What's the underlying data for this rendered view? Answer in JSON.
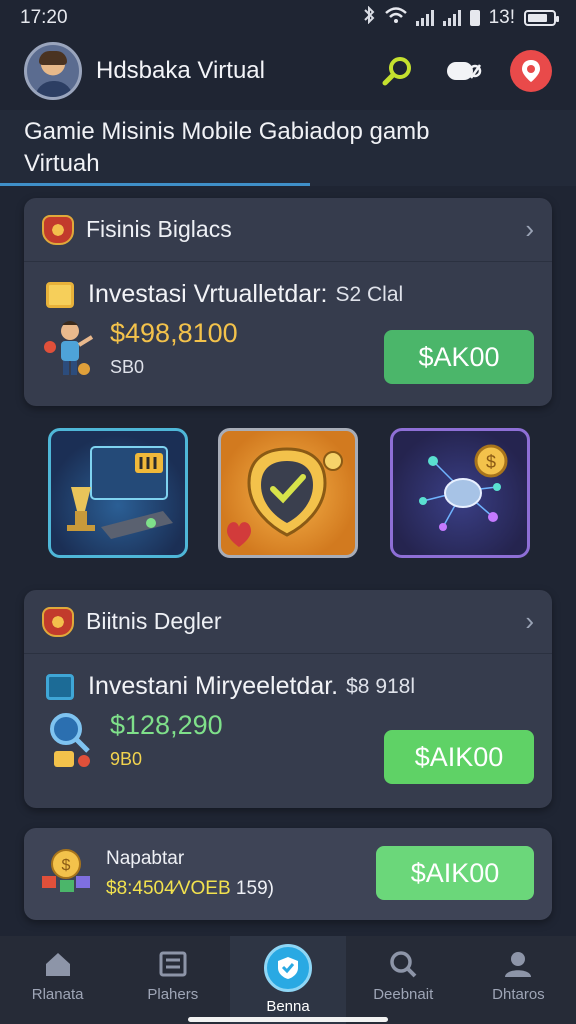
{
  "status_bar": {
    "time": "17:20",
    "right_text": "13!"
  },
  "header": {
    "app_title": "Hdsbaka Virtual",
    "icons": [
      "search-icon",
      "toggle-icon",
      "location-pin-icon"
    ]
  },
  "headline": {
    "line1": "Gamie Misinis Mobile Gabiadop gamb",
    "line2": "Virtuah"
  },
  "card1": {
    "title": "Fisinis Biglacs",
    "invest_label": "Investasi Vrtualletdar:",
    "invest_sub": "S2 Clal",
    "amount": "$498,8100",
    "amount_sub": "SB0",
    "button": "$AK00"
  },
  "tiles": [
    "analytics-tile-icon",
    "shield-check-tile-icon",
    "network-coin-tile-icon"
  ],
  "card2": {
    "title": "Biitnis Degler",
    "invest_label": "Investani Miryeeletdar.",
    "invest_sub": "$8 918l",
    "amount": "$128,290",
    "amount_sub": "9B0",
    "button": "$AIK00"
  },
  "card3": {
    "title": "Napabtar",
    "detail_prefix": "$8:4504∕VOEB",
    "detail_suffix": " 159)",
    "button": "$AIK00"
  },
  "bottom_nav": {
    "items": [
      {
        "label": "Rlanata",
        "icon": "home-icon"
      },
      {
        "label": "Plahers",
        "icon": "list-icon"
      },
      {
        "label": "Benna",
        "icon": "shield-nav-icon"
      },
      {
        "label": "Deebnait",
        "icon": "search-icon"
      },
      {
        "label": "Dhtaros",
        "icon": "user-icon"
      }
    ]
  },
  "colors": {
    "background": "#1f2533",
    "card": "#363c4d",
    "accent_green": "#4bb66a",
    "accent_blue": "#29a9e3",
    "amount_gold": "#f3c24b",
    "amount_green": "#7fe08a"
  }
}
